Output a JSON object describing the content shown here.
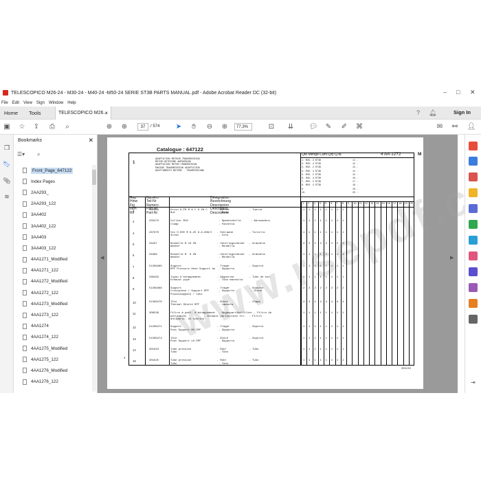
{
  "window": {
    "title": "TELESCOPICO M26-24 - M30-24 - M40-24 -M50-24 SERIE ST3B PARTS MANUAL.pdf - Adobe Acrobat Reader DC (32-bit)",
    "controls": [
      "–",
      "□",
      "✕"
    ]
  },
  "menu": [
    "File",
    "Edit",
    "View",
    "Sign",
    "Window",
    "Help"
  ],
  "tabs": {
    "home": "Home",
    "tools": "Tools",
    "document": "TELESCOPICO M26...",
    "close": "×",
    "signin": "Sign In"
  },
  "toolbar": {
    "page_current": "37",
    "page_total": "/ 574",
    "zoom": "77,3%"
  },
  "bookmarks": {
    "title": "Bookmarks",
    "close": "✕",
    "items": [
      {
        "label": "Front_Page_647122",
        "selected": true
      },
      {
        "label": "Index Pages"
      },
      {
        "label": "2AA293_"
      },
      {
        "label": "2AA293_122"
      },
      {
        "label": "3AA402"
      },
      {
        "label": "3AA402_122"
      },
      {
        "label": "3AA403"
      },
      {
        "label": "3AA403_122"
      },
      {
        "label": "4AA1271_Modified"
      },
      {
        "label": "4AA1271_122"
      },
      {
        "label": "4AA1272_Modified"
      },
      {
        "label": "4AA1272_122"
      },
      {
        "label": "4AA1273_Modified"
      },
      {
        "label": "4AA1273_122"
      },
      {
        "label": "4AA1274"
      },
      {
        "label": "4AA1274_122"
      },
      {
        "label": "4AA1275_Modified"
      },
      {
        "label": "4AA1275_122"
      },
      {
        "label": "4AA1276_Modified"
      },
      {
        "label": "4AA1276_122"
      }
    ]
  },
  "pdf_page": {
    "catalogue": "Catalogue :  647122",
    "group_num": "1",
    "group_desc": "ADAPTATION MOTEUR-TRANSMISSION\nMOTOR-GETRIEBE ANPASSUNG\nADAPTACION MOTOR-TRANSMISION\nENGINE-TRANSMISSION ADAPTATION\nADATTAMENTO MOTORE - TRASMISSIONE",
    "qty_header": "Qte.Menge-Cant-Qty-Q.ta",
    "part_code": "4 AA 1272",
    "letter_m": "M",
    "models": "1- M26- 2 ST3B\n2- M26- 4 ST3B\n3- M30- 2 ST3B\n4- M30- 4 ST3B\n5- M40- 2 ST3B\n6- M40- 4 ST3B\n7- M50- 2 ST3B\n8- M50- 4 ST3B\n9-\n10-",
    "models_right": "11 -\n12 -\n13 -\n14 -\n15 -\n16 -\n17 -\n18 -\n19 -\n20 -",
    "col_rep": "Rep\nHinw\nFig\nItem\nRif",
    "col_numero": "Numéro\nTeil-Nr\nNumero\nPart-Nr\nPart-Nr",
    "col_designation": "Désignation\nBezeichnung\nDescripcion\nDescription\nDescrizione",
    "qty_cols": [
      "1",
      "2",
      "3",
      "4",
      "5",
      "6",
      "7",
      "8",
      "9",
      "10",
      "11",
      "12",
      "13",
      "14",
      "15",
      "16",
      "17",
      "18",
      "19",
      "20"
    ],
    "rows": [
      {
        "rep": "1",
        "num": "142229",
        "desc": "Ecrou H_FR M 8 C 8 ZN C      - Mutter            - Tuerca\nNut                           - Dado",
        "qty": "1 1 1 1 1 1 1 1"
      },
      {
        "rep": "2",
        "num": "250473",
        "desc": "Collier M10                   - Spannschelle      - Abrazadera\nClamp                         - Fascetta",
        "qty": "1 1 1 1 1 1 1 1"
      },
      {
        "rep": "4",
        "num": "267970",
        "desc": "Vis H EEE M 8-25 8.8-ZN8/C   - Schraube          - Tornillo\nScrew                         - Vite",
        "qty": "1 1 1 1 1 1 1 1"
      },
      {
        "rep": "5",
        "num": "29437",
        "desc": "Rondelle M 10 ZN             - Unterlegscheibe   - Arandela\nWasher                        - Rondella",
        "qty": "2 2 2 2 2 2 2 2"
      },
      {
        "rep": "6",
        "num": "29469",
        "desc": "Rondelle M  8 ZN             - Unterlegscheibe   - Arandela\nWasher                        - Rondella",
        "qty": "1 1 1 1 1 1 1 1"
      },
      {
        "rep": "7",
        "num": "51309460",
        "desc": "Support                      - Träger            - Soporte\nDPF Pressure Hose Support As  - Supporto",
        "qty": "1 1 1 1 1 1 1 1"
      },
      {
        "rep": "8",
        "num": "299493",
        "desc": "Tuyau d'échappement          - Abgasrohr         - Tubo de esc.\nExhaust pipe                  - Tubo marmitta",
        "qty": "1 1 1 1 1 1 1 1"
      },
      {
        "rep": "9",
        "num": "51309468",
        "desc": "Support                      - Träger            - Soporte\nCrosspiece / Support DPF      - Supporto          - Steun\nPoikkikappale / teki",
        "qty": "2 2 2 2 2 2 2 2"
      },
      {
        "rep": "10",
        "num": "51309470",
        "desc": "Tôle                         - Blech             - Chapa\nThermal Shield DPF            - Lamiera",
        "qty": "4 4 4 4 4 4 4 4"
      },
      {
        "rep": "11",
        "num": "306538",
        "desc": "Filtre à part. d'échappement  - Abgaspartikelfilter - Filtro de\nparticules           - Exhaust particulate fil.  - Filtro\nantiparti. di scarico",
        "qty": "1 1 1 1 1 1 1 1"
      },
      {
        "rep": "12",
        "num": "51309471",
        "desc": "Support                      - Träger            - Soporte\nPost Support RH DPF           - Supporto",
        "qty": "1 1 1 1 1 1 1 1"
      },
      {
        "rep": "13",
        "num": "51309474",
        "desc": "Tôle                         - Blech             - Soporte\nPost Support LH DPF           - Supporto",
        "qty": "1 1 1 1 1 1 1 1"
      },
      {
        "rep": "14",
        "num": "301823",
        "desc": "Tube pression                - Rohr              - Tubo\nTubo                          - Tubo",
        "qty": "1 1 1 1 1 1 1 1"
      },
      {
        "rep": "15",
        "num": "301825",
        "desc": "Tube pression                - Rohr              - Tubo\nTubo                          - Tubo",
        "qty": "1 1 1 1 1 1 1 1"
      }
    ],
    "date": "30/11/15",
    "star": "*"
  }
}
